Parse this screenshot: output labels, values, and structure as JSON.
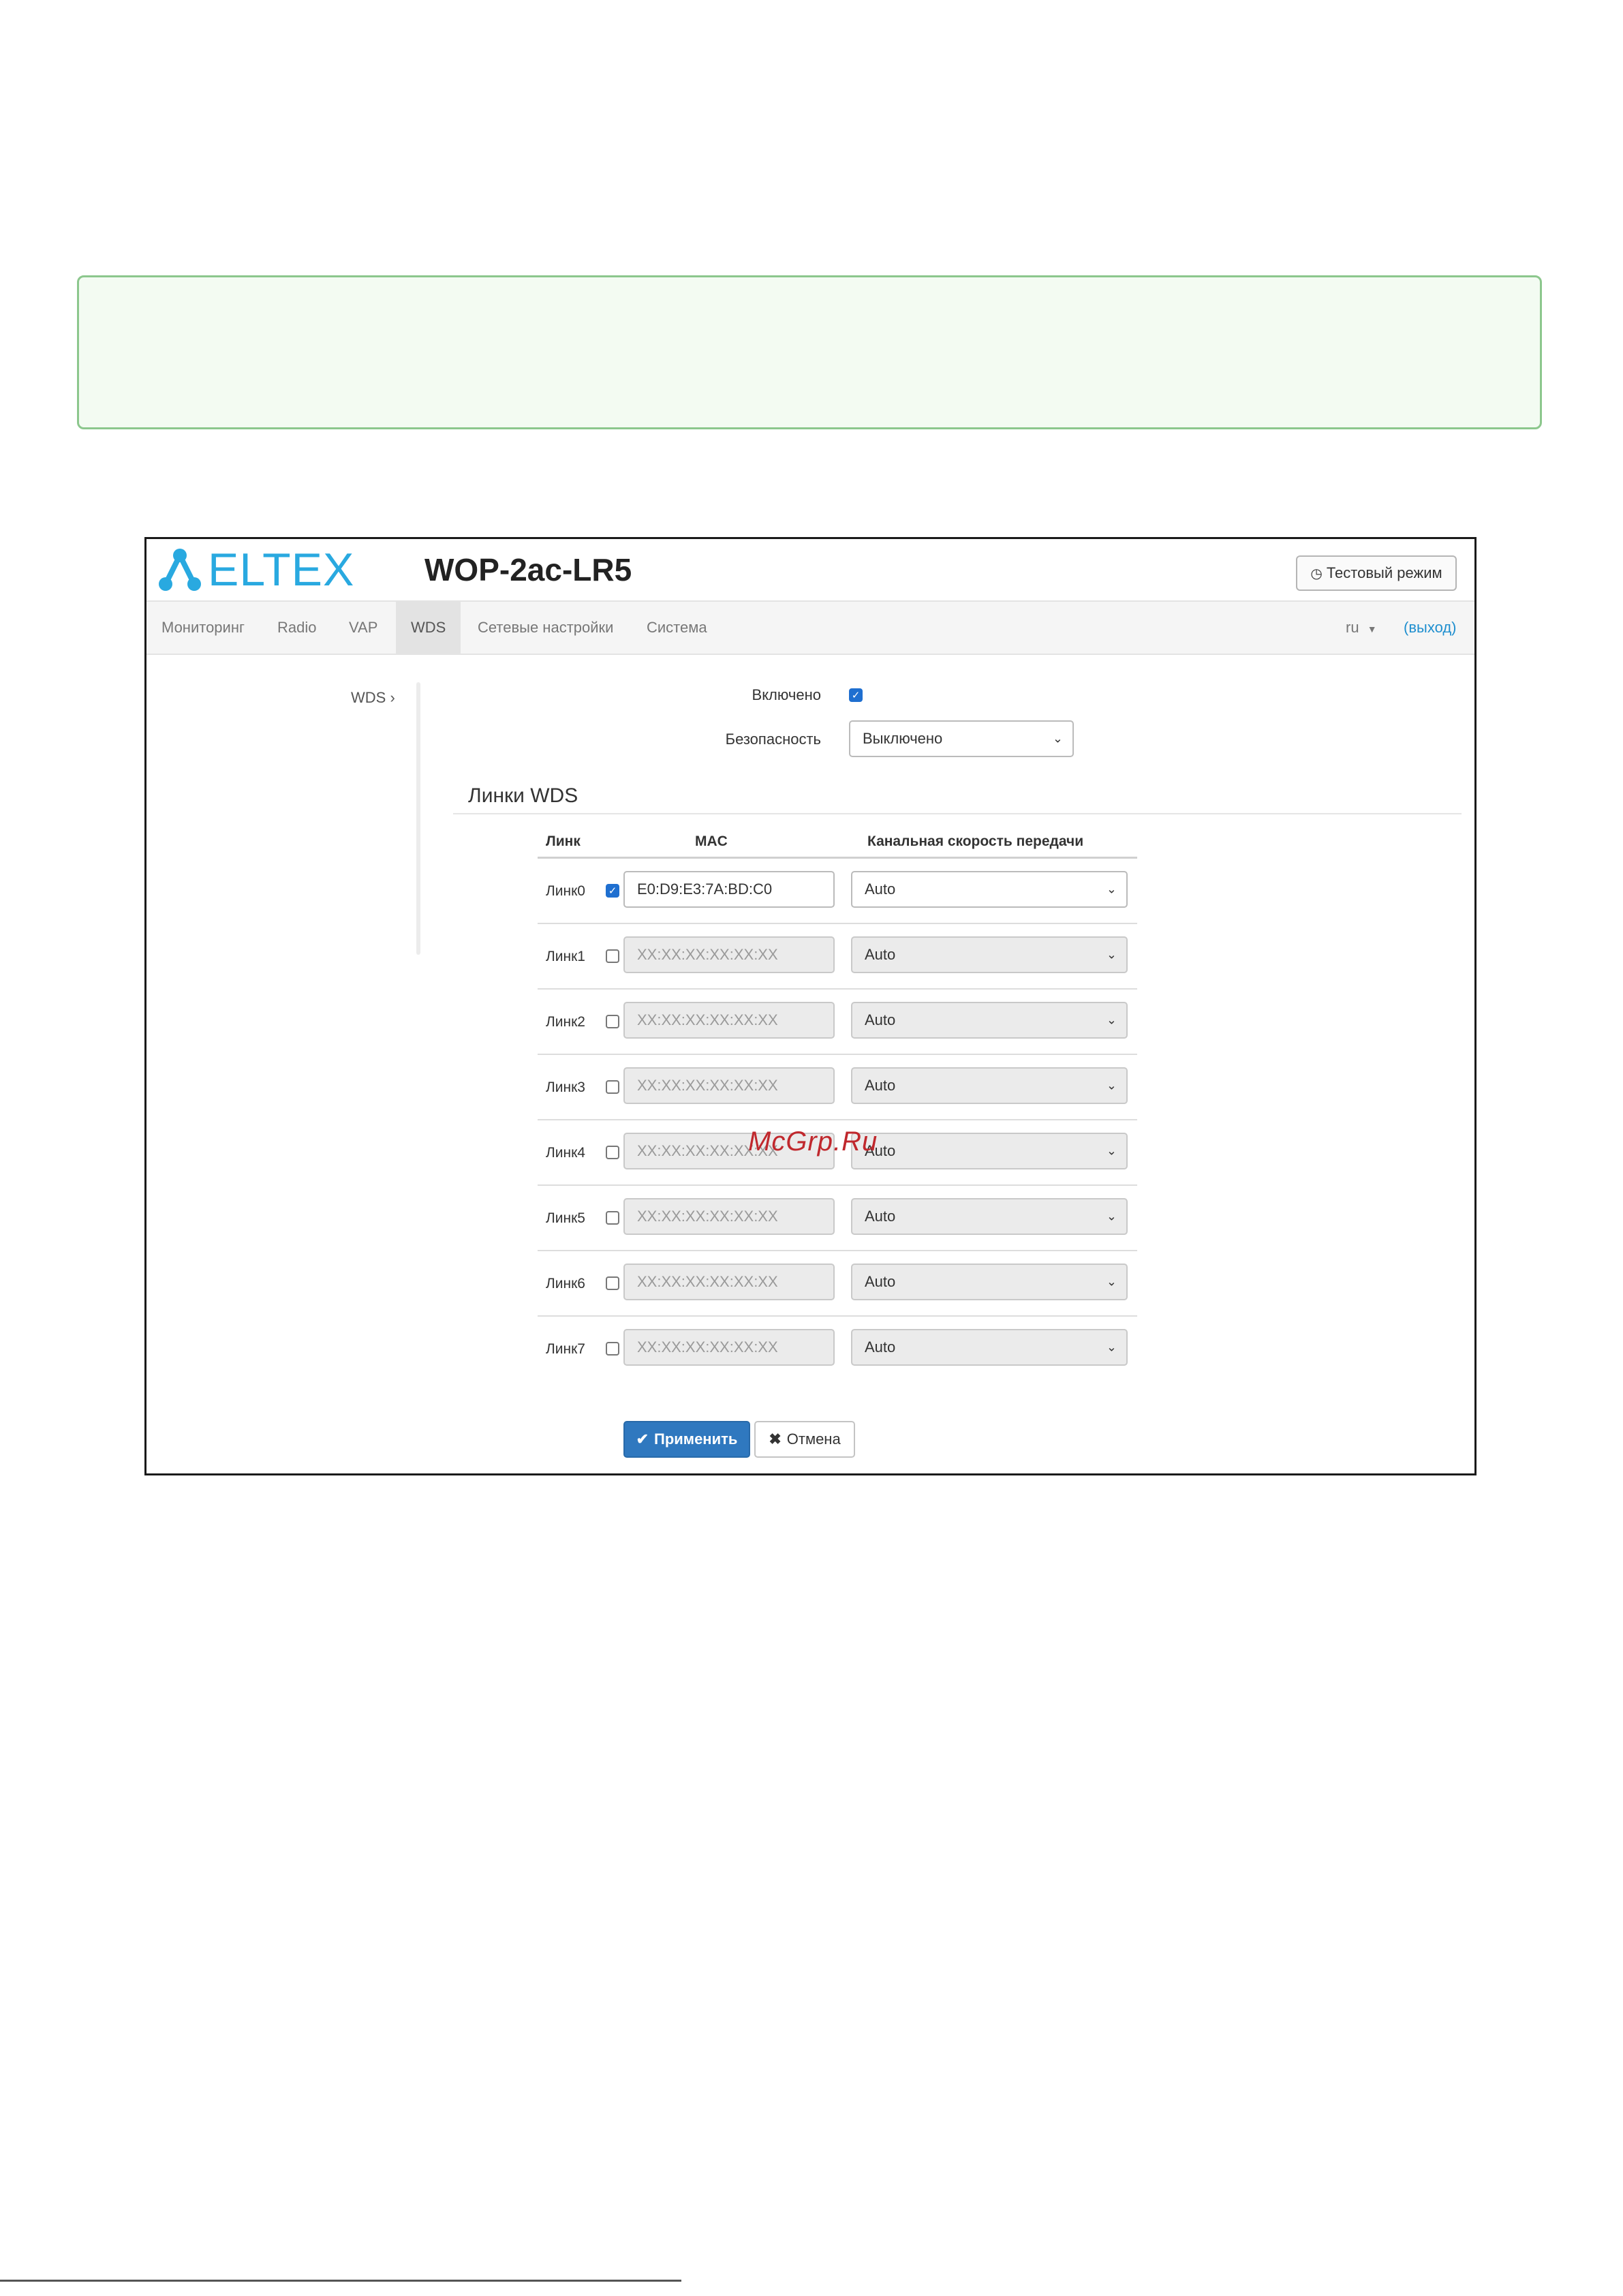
{
  "header": {
    "logo_text": "ELTEX",
    "device_title": "WOP-2ac-LR5",
    "test_mode_button": "Тестовый режим"
  },
  "nav": {
    "items": [
      {
        "label": "Мониторинг"
      },
      {
        "label": "Radio"
      },
      {
        "label": "VAP"
      },
      {
        "label": "WDS",
        "active": true
      },
      {
        "label": "Сетевые настройки"
      },
      {
        "label": "Система"
      }
    ],
    "language": "ru",
    "logout": "(выход)"
  },
  "sidebar": {
    "items": [
      {
        "label": "WDS"
      }
    ]
  },
  "form": {
    "enabled_label": "Включено",
    "enabled_checked": true,
    "security_label": "Безопасность",
    "security_value": "Выключено"
  },
  "links_section": {
    "title": "Линки WDS",
    "columns": [
      "Линк",
      "MAC",
      "Канальная скорость передачи"
    ],
    "rows": [
      {
        "label": "Линк0",
        "checked": true,
        "mac": "E0:D9:E3:7A:BD:C0",
        "rate": "Auto",
        "disabled": false
      },
      {
        "label": "Линк1",
        "checked": false,
        "mac_placeholder": "XX:XX:XX:XX:XX:XX",
        "rate": "Auto",
        "disabled": true
      },
      {
        "label": "Линк2",
        "checked": false,
        "mac_placeholder": "XX:XX:XX:XX:XX:XX",
        "rate": "Auto",
        "disabled": true
      },
      {
        "label": "Линк3",
        "checked": false,
        "mac_placeholder": "XX:XX:XX:XX:XX:XX",
        "rate": "Auto",
        "disabled": true
      },
      {
        "label": "Линк4",
        "checked": false,
        "mac_placeholder": "XX:XX:XX:XX:XX:XX",
        "rate": "Auto",
        "disabled": true
      },
      {
        "label": "Линк5",
        "checked": false,
        "mac_placeholder": "XX:XX:XX:XX:XX:XX",
        "rate": "Auto",
        "disabled": true
      },
      {
        "label": "Линк6",
        "checked": false,
        "mac_placeholder": "XX:XX:XX:XX:XX:XX",
        "rate": "Auto",
        "disabled": true
      },
      {
        "label": "Линк7",
        "checked": false,
        "mac_placeholder": "XX:XX:XX:XX:XX:XX",
        "rate": "Auto",
        "disabled": true
      }
    ]
  },
  "actions": {
    "apply": "Применить",
    "cancel": "Отмена"
  },
  "watermark": "McGrp.Ru",
  "colors": {
    "brand": "#29a9e0",
    "primary_button": "#2f78bf",
    "link": "#1f8fcf",
    "note_border": "#8cc78d",
    "checkbox_checked": "#1f6fd0"
  }
}
